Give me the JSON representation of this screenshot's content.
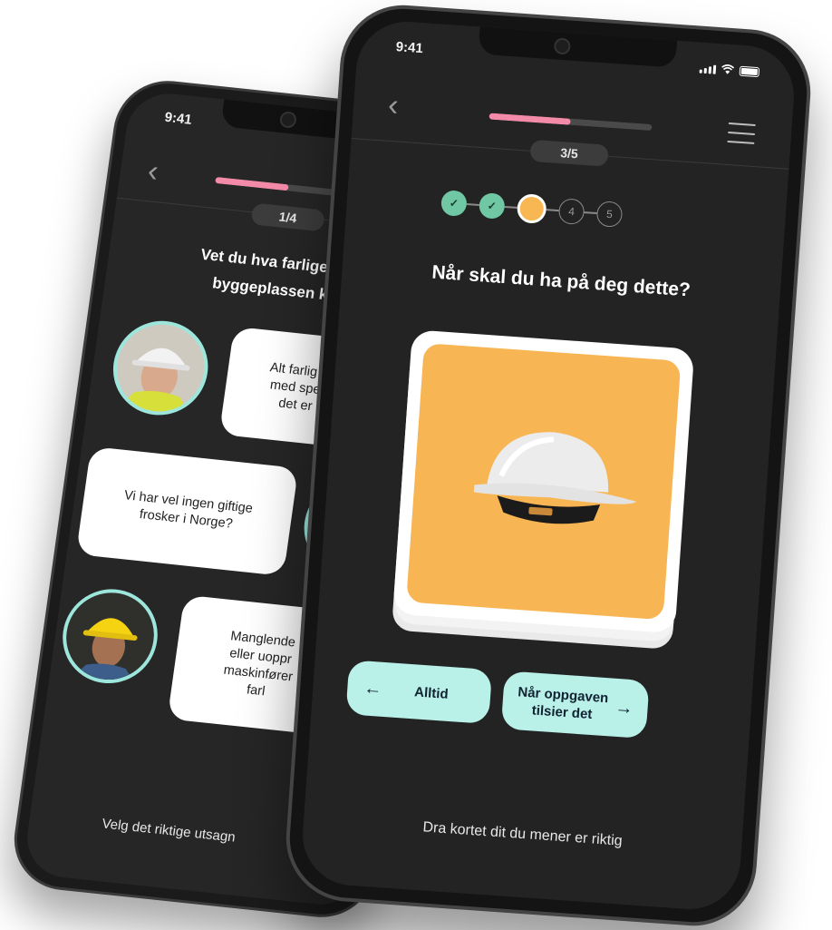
{
  "back_phone": {
    "status_time": "9:41",
    "step_label": "1/4",
    "progress": 0.45,
    "question_line1": "Vet du hva farlige møns",
    "question_line2": "byggeplassen kan væ",
    "chat": [
      {
        "text_lines": [
          "Alt farlig ska",
          "med sperre",
          "det er e"
        ],
        "side": "avatar-left"
      },
      {
        "text_lines": [
          "Vi har vel ingen giftige",
          "frosker i Norge?"
        ],
        "side": "avatar-right"
      },
      {
        "text_lines": [
          "Manglende",
          "eller uoppr",
          "maskinfører",
          "farl"
        ],
        "side": "avatar-left"
      }
    ],
    "footer": "Velg det riktige utsagn"
  },
  "front_phone": {
    "status_time": "9:41",
    "step_label": "3/5",
    "progress": 0.5,
    "steps": [
      {
        "state": "done",
        "label": "✓"
      },
      {
        "state": "done",
        "label": "✓"
      },
      {
        "state": "current",
        "label": ""
      },
      {
        "state": "todo",
        "label": "4"
      },
      {
        "state": "todo",
        "label": "5"
      }
    ],
    "question": "Når skal du ha på deg dette?",
    "card_color": "#f8b553",
    "left_button": {
      "arrow": "←",
      "label": "Alltid"
    },
    "right_button": {
      "arrow": "→",
      "label_line1": "Når oppgaven",
      "label_line2": "tilsier det"
    },
    "footer": "Dra kortet dit du mener er riktig"
  },
  "colors": {
    "accent_pink": "#f28aa8",
    "accent_mint": "#b9f0e8",
    "step_done": "#6fc7a4",
    "step_current": "#f8b753"
  }
}
